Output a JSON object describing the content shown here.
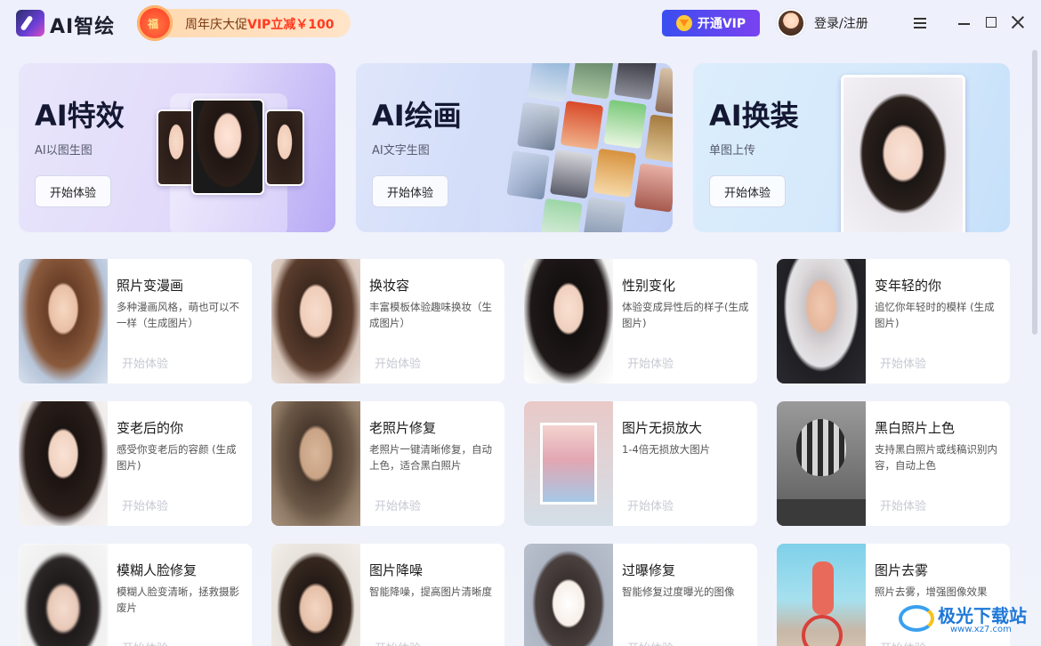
{
  "app": {
    "name": "AI智绘"
  },
  "promo": {
    "text_pre": "周年庆大促",
    "text_highlight": "VIP立减￥100"
  },
  "header": {
    "vip_label": "开通VIP",
    "login_label": "登录/注册"
  },
  "banners": [
    {
      "title": "AI特效",
      "subtitle": "AI以图生图",
      "button": "开始体验"
    },
    {
      "title": "AI绘画",
      "subtitle": "AI文字生图",
      "button": "开始体验"
    },
    {
      "title": "AI换装",
      "subtitle": "单图上传",
      "button": "开始体验"
    }
  ],
  "features": [
    {
      "title": "照片变漫画",
      "desc": "多种漫画风格，萌也可以不一样（生成图片）",
      "button": "开始体验"
    },
    {
      "title": "换妆容",
      "desc": "丰富模板体验趣味换妆（生成图片）",
      "button": "开始体验"
    },
    {
      "title": "性别变化",
      "desc": "体验变成异性后的样子(生成图片)",
      "button": "开始体验"
    },
    {
      "title": "变年轻的你",
      "desc": "追忆你年轻时的模样 (生成图片)",
      "button": "开始体验"
    },
    {
      "title": "变老后的你",
      "desc": "感受你变老后的容颜 (生成图片)",
      "button": "开始体验"
    },
    {
      "title": "老照片修复",
      "desc": "老照片一键清晰修复，自动上色，适合黑白照片",
      "button": "开始体验"
    },
    {
      "title": "图片无损放大",
      "desc": "1-4倍无损放大图片",
      "button": "开始体验"
    },
    {
      "title": "黑白照片上色",
      "desc": "支持黑白照片或线稿识别内容，自动上色",
      "button": "开始体验"
    },
    {
      "title": "模糊人脸修复",
      "desc": "模糊人脸变清晰，拯救摄影废片",
      "button": "开始体验"
    },
    {
      "title": "图片降噪",
      "desc": "智能降噪，提高图片清晰度",
      "button": "开始体验"
    },
    {
      "title": "过曝修复",
      "desc": "智能修复过度曝光的图像",
      "button": "开始体验"
    },
    {
      "title": "图片去雾",
      "desc": "照片去雾，增强图像效果",
      "button": "开始体验"
    }
  ],
  "watermark": {
    "text": "极光下载站",
    "url": "www.xz7.com"
  }
}
